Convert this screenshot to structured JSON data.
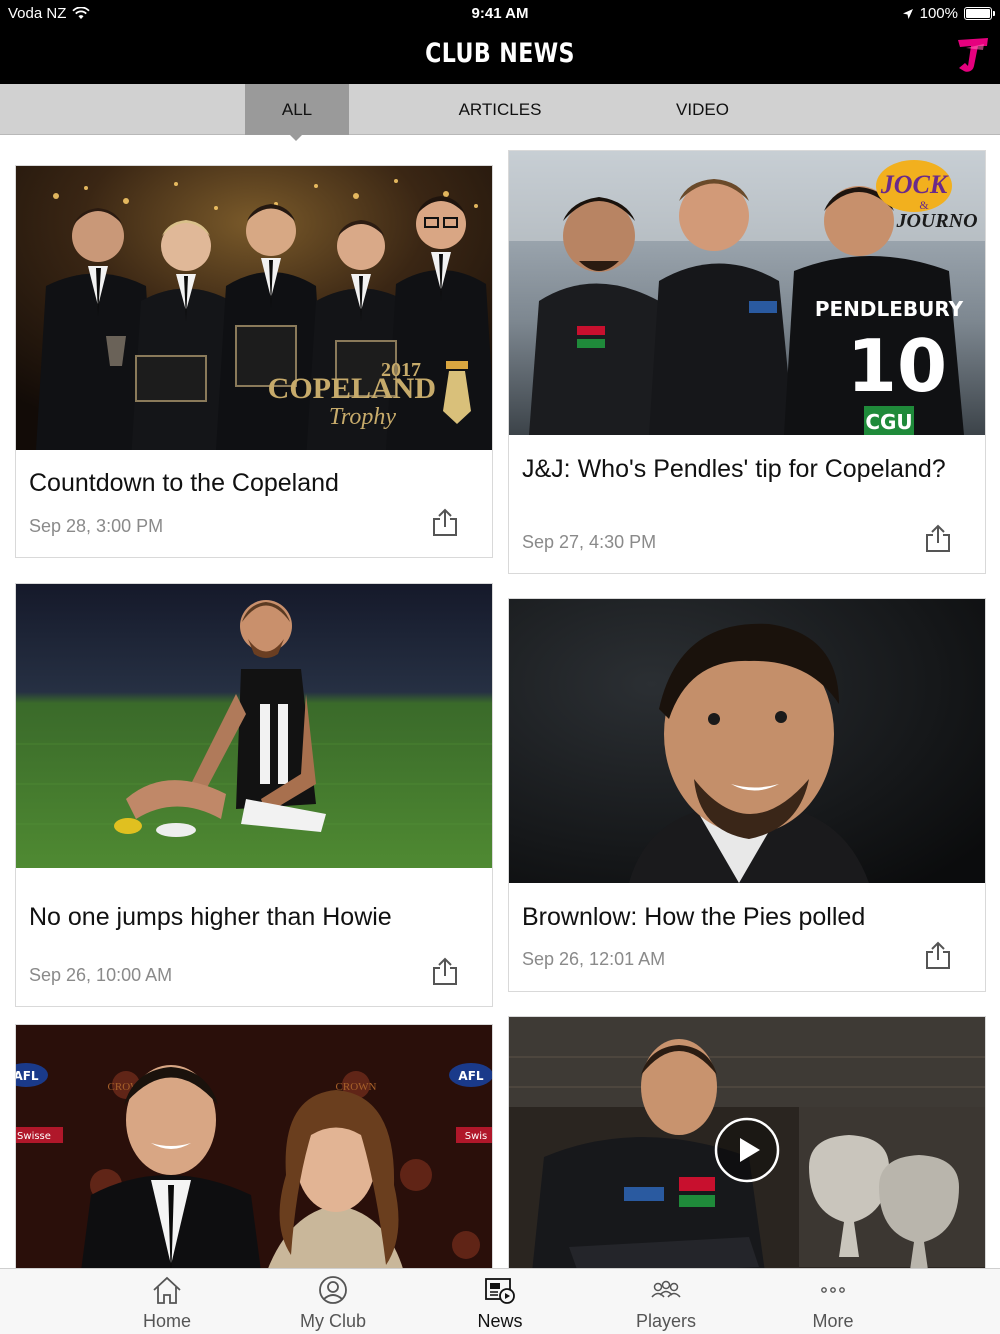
{
  "status_bar": {
    "carrier": "Voda NZ",
    "time": "9:41 AM",
    "battery": "100%"
  },
  "header": {
    "title": "CLUB NEWS"
  },
  "tabs": [
    {
      "label": "ALL",
      "active": true
    },
    {
      "label": "ARTICLES",
      "active": false
    },
    {
      "label": "VIDEO",
      "active": false
    }
  ],
  "cards": [
    {
      "title": "Countdown to the Copeland",
      "date": "Sep 28, 3:00 PM",
      "image_text": [
        "2017",
        "COPELAND",
        "Trophy"
      ]
    },
    {
      "title": "J&J: Who's Pendles' tip for Copeland?",
      "date": "Sep 27, 4:30 PM",
      "image_text": [
        "JOCK",
        "&",
        "JOURNO",
        "PENDLEBURY",
        "10",
        "CGU"
      ]
    },
    {
      "title": "No one jumps higher than Howie",
      "date": "Sep 26, 10:00 AM"
    },
    {
      "title": "Brownlow: How the Pies polled",
      "date": "Sep 26, 12:01 AM"
    },
    {
      "title": "",
      "date": "",
      "image_text": [
        "CROWN",
        "CROWN",
        "AFL",
        "AFL",
        "Swisse",
        "Swis"
      ]
    },
    {
      "title": "",
      "date": "",
      "video": true
    }
  ],
  "tabbar": [
    {
      "label": "Home",
      "icon": "home-icon",
      "active": false
    },
    {
      "label": "My Club",
      "icon": "user-circle-icon",
      "active": false
    },
    {
      "label": "News",
      "icon": "news-icon",
      "active": true
    },
    {
      "label": "Players",
      "icon": "players-icon",
      "active": false
    },
    {
      "label": "More",
      "icon": "more-dots-icon",
      "active": false
    }
  ],
  "colors": {
    "topbar_bg": "#000000",
    "tabs_bg": "#d1d1d1",
    "tab_active_bg": "#9a9a9a",
    "brand_pink": "#e6007e"
  }
}
